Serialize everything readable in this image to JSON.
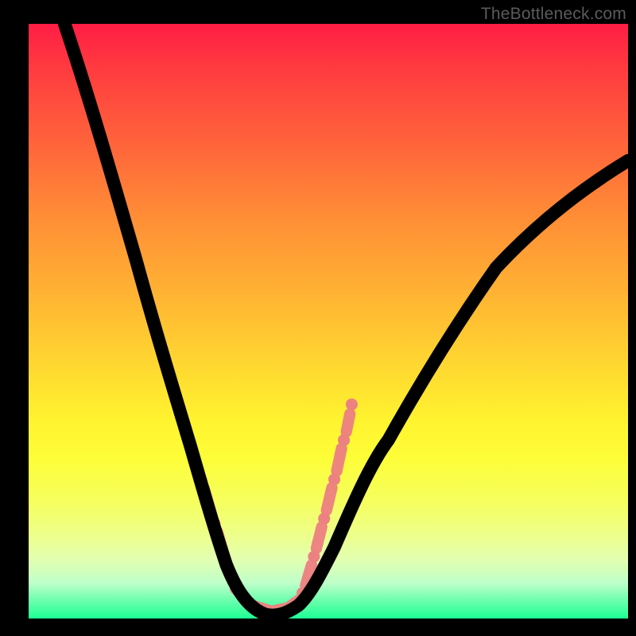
{
  "watermark": "TheBottleneck.com",
  "colors": {
    "salmon": "#ec8181",
    "curve": "#000000"
  },
  "chart_data": {
    "type": "line",
    "title": "",
    "xlabel": "",
    "ylabel": "",
    "xlim": [
      0,
      100
    ],
    "ylim": [
      0,
      100
    ],
    "legend": false,
    "grid": false,
    "series": [
      {
        "name": "bottleneck-curve",
        "x": [
          6,
          10,
          14,
          18,
          22,
          25,
          27,
          29,
          31,
          33,
          35,
          37,
          39.5,
          42,
          45,
          48,
          51,
          55,
          60,
          66,
          72,
          78,
          85,
          92,
          100
        ],
        "y": [
          100,
          88,
          74,
          60,
          46,
          36,
          29,
          22,
          15,
          9,
          5,
          2,
          0.5,
          0.5,
          2,
          6,
          12,
          20,
          30,
          41,
          51,
          59,
          66,
          72,
          77
        ]
      }
    ],
    "highlight_band": {
      "note": "salmon dotted band near trough",
      "color": "#ec8181",
      "left_segment_x": [
        24,
        33
      ],
      "left_segment_y": [
        38,
        9
      ],
      "floor_segment_x": [
        35,
        45
      ],
      "floor_segment_y": [
        2,
        2
      ],
      "right_segment_x": [
        44,
        52
      ],
      "right_segment_y": [
        4,
        36
      ]
    },
    "gradient_stops": [
      {
        "pos": 0.0,
        "color": "#ff1d44"
      },
      {
        "pos": 0.07,
        "color": "#ff3940"
      },
      {
        "pos": 0.22,
        "color": "#ff6a3a"
      },
      {
        "pos": 0.33,
        "color": "#ff8f36"
      },
      {
        "pos": 0.45,
        "color": "#ffb233"
      },
      {
        "pos": 0.56,
        "color": "#ffd331"
      },
      {
        "pos": 0.67,
        "color": "#fff42f"
      },
      {
        "pos": 0.73,
        "color": "#fdfd38"
      },
      {
        "pos": 0.8,
        "color": "#f6ff5c"
      },
      {
        "pos": 0.85,
        "color": "#efff82"
      },
      {
        "pos": 0.9,
        "color": "#e3ffb0"
      },
      {
        "pos": 0.94,
        "color": "#bfffc9"
      },
      {
        "pos": 0.97,
        "color": "#6bffad"
      },
      {
        "pos": 1.0,
        "color": "#1dff94"
      }
    ]
  }
}
